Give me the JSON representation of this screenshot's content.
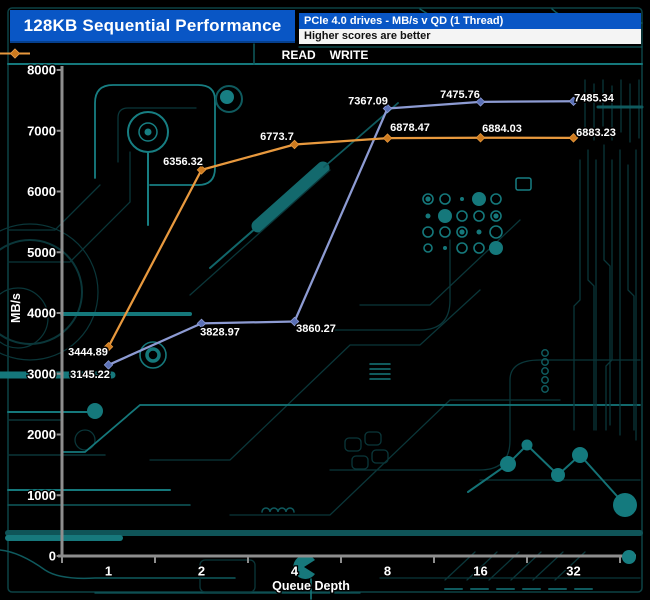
{
  "header": {
    "title": "128KB Sequential Performance",
    "subtitle": "PCIe 4.0 drives - MB/s v QD (1 Thread)",
    "note": "Higher scores are better"
  },
  "colors": {
    "header_blue": "#0956c5",
    "note_bg": "#f4f4f4",
    "axis_gray": "#8e8e8e",
    "background": "#000000",
    "circuit_teal_bright": "#177e82",
    "circuit_teal_mid": "#0f5a5e",
    "circuit_teal_dim": "#0a3639",
    "read_line": "#8d9bd3",
    "read_marker": "#5a70b6",
    "write_line": "#e8993e",
    "write_marker": "#cc7a1f",
    "label_text": "#ffffff"
  },
  "chart_data": {
    "type": "line",
    "title": "128KB Sequential Performance",
    "categories": [
      "1",
      "2",
      "4",
      "8",
      "16",
      "32"
    ],
    "xlabel": "Queue Depth",
    "ylabel": "MB/s",
    "ylim": [
      0,
      8000
    ],
    "ytick_step": 1000,
    "grid": false,
    "legend_position": "top-center",
    "series": [
      {
        "name": "READ",
        "color": "#8d9bd3",
        "marker_color": "#5a70b6",
        "marker": "diamond",
        "values": [
          3145.22,
          3828.97,
          3860.27,
          7367.09,
          7475.76,
          7485.34
        ],
        "label_offsets": [
          [
            -18.5,
            9
          ],
          [
            18.5,
            8
          ],
          [
            21.5,
            6.5
          ],
          [
            -19.5,
            -8
          ],
          [
            -20.5,
            -8
          ],
          [
            20.5,
            -4
          ]
        ]
      },
      {
        "name": "WRITE",
        "color": "#e8993e",
        "marker_color": "#cc7a1f",
        "marker": "diamond",
        "values": [
          3444.89,
          6356.32,
          6773.7,
          6878.47,
          6884.03,
          6883.23
        ],
        "label_offsets": [
          [
            -20.5,
            5
          ],
          [
            -18.5,
            -9
          ],
          [
            -17.5,
            -8.5
          ],
          [
            22.5,
            -11
          ],
          [
            21.5,
            -10
          ],
          [
            22.5,
            -6
          ]
        ]
      }
    ]
  }
}
